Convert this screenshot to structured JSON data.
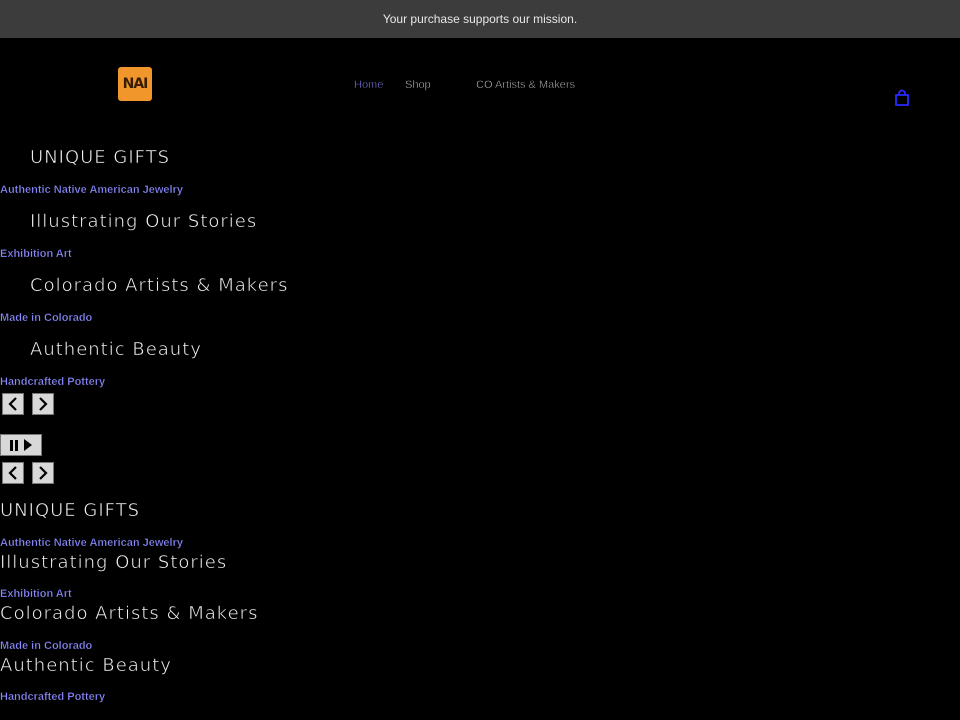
{
  "announcement": {
    "text": "Your purchase supports our mission."
  },
  "header": {
    "logo_text": "NAI",
    "nav": [
      {
        "label": "Home"
      },
      {
        "label": "Shop"
      },
      {
        "label": "CO Artists & Makers"
      }
    ],
    "cart_icon": "shopping-bag-icon"
  },
  "slideshow": {
    "slides": [
      {
        "heading": "UNIQUE GIFTS",
        "link": "Authentic Native American Jewelry"
      },
      {
        "heading": "Illustrating Our Stories",
        "link": "Exhibition Art"
      },
      {
        "heading": "Colorado Artists & Makers",
        "link": "Made in Colorado"
      },
      {
        "heading": "Authentic Beauty",
        "link": "Handcrafted Pottery"
      }
    ],
    "controls": {
      "prev_icon": "chevron-left-icon",
      "next_icon": "chevron-right-icon",
      "pause_icon": "pause-icon",
      "play_icon": "play-icon"
    }
  },
  "colors": {
    "background": "#000000",
    "announcement_bg": "#3c3c3c",
    "link": "#8a8aff",
    "logo": "#f0962a"
  }
}
